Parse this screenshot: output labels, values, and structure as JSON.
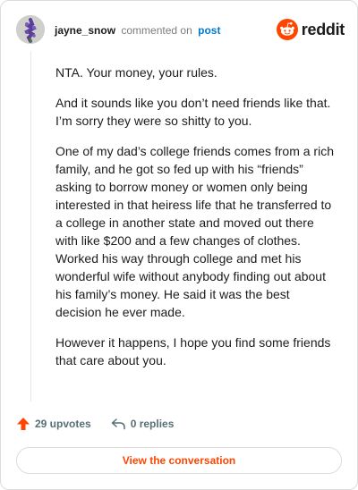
{
  "header": {
    "username": "jayne_snow",
    "action": "commented on",
    "post_link": "post",
    "brand": "reddit"
  },
  "comment": {
    "paragraphs": [
      "NTA. Your money, your rules.",
      "And it sounds like you don’t need friends like that. I’m sorry they were so shitty to you.",
      "One of my dad’s college friends comes from a rich family, and he got so fed up with his “friends” asking to borrow money or women only being interested in that heiress life that he transferred to a college in another state and moved out there with like $200 and a few changes of clothes. Worked his way through college and met his wonderful wife without anybody finding out about his family’s money. He said it was the best decision he ever made.",
      "However it happens, I hope you find some friends that care about you."
    ]
  },
  "footer": {
    "upvotes": "29 upvotes",
    "replies": "0 replies"
  },
  "view_button": "View the conversation",
  "colors": {
    "reddit_orange": "#ff4500",
    "link_blue": "#0079d3",
    "muted": "#576f76"
  },
  "icons": {
    "upvote": "upvote-arrow-icon",
    "reply": "reply-arrow-icon",
    "brand": "reddit-snoo-icon"
  }
}
